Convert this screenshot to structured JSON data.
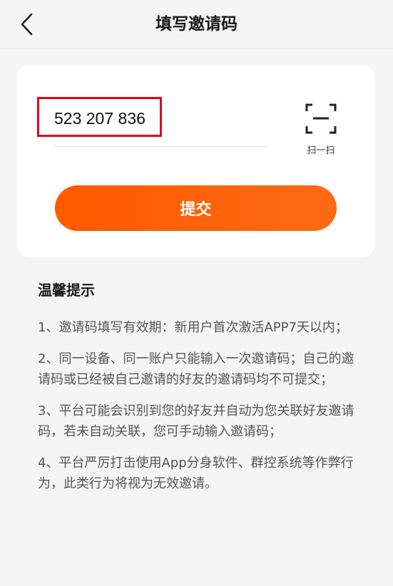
{
  "nav": {
    "title": "填写邀请码",
    "back_icon": "chevron-left-icon"
  },
  "invite": {
    "code_value": "523 207 836",
    "scan_icon": "scan-frame-icon",
    "scan_label": "扫一扫",
    "submit_label": "提交",
    "accent_color": "#ff6010",
    "highlight_color": "#e0001a"
  },
  "tips": {
    "title": "温馨提示",
    "items": [
      "1、邀请码填写有效期：新用户首次激活APP7天以内；",
      "2、同一设备、同一账户只能输入一次邀请码；自己的邀请码或已经被自己邀请的好友的邀请码均不可提交；",
      "3、平台可能会识别到您的好友并自动为您关联好友邀请码，若未自动关联，您可手动输入邀请码；",
      "4、平台严厉打击使用App分身软件、群控系统等作弊行为，此类行为将视为无效邀请。"
    ]
  }
}
